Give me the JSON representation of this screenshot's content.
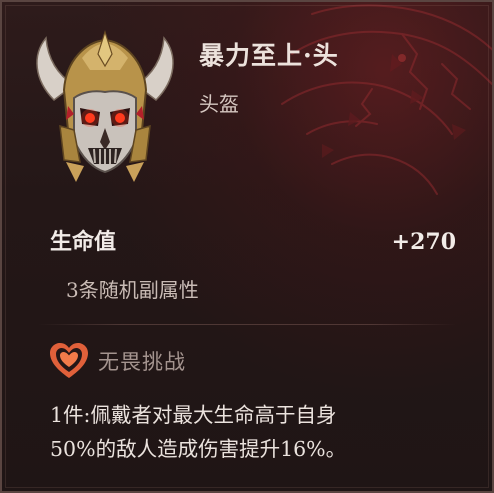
{
  "item": {
    "name": "暴力至上·头",
    "slot": "头盔"
  },
  "stats": {
    "main_label": "生命值",
    "main_value": "+270",
    "affix_text": "3条随机副属性"
  },
  "set_bonus": {
    "name": "无畏挑战",
    "desc_line1": "1件:佩戴者对最大生命高于自身",
    "desc_line2": "50%的敌人造成伤害提升16%。"
  },
  "colors": {
    "background": "#241717",
    "accent_gold": "#c9a15a",
    "set_icon": "#e0603a",
    "dragon_red": "#7a1e22"
  },
  "icons": {
    "item_art": "demon-helmet-icon",
    "set_icon": "heart-shield-icon",
    "background_art": "dragon-head-art"
  }
}
